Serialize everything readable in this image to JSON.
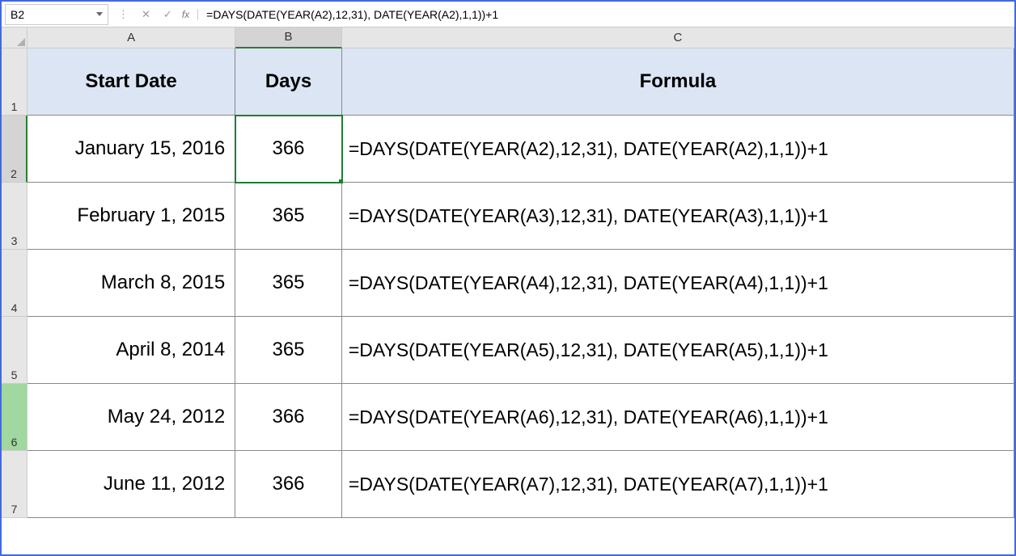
{
  "formula_bar": {
    "cell_ref": "B2",
    "fx_label": "fx",
    "formula": "=DAYS(DATE(YEAR(A2),12,31), DATE(YEAR(A2),1,1))+1"
  },
  "columns": [
    "A",
    "B",
    "C"
  ],
  "active_column": "B",
  "row_numbers": [
    "1",
    "2",
    "3",
    "4",
    "5",
    "6",
    "7"
  ],
  "active_row": "2",
  "selected_rows": [
    "6"
  ],
  "headers": {
    "start_date": "Start Date",
    "days": "Days",
    "formula": "Formula"
  },
  "rows": [
    {
      "start_date": "January 15, 2016",
      "days": "366",
      "formula": "=DAYS(DATE(YEAR(A2),12,31), DATE(YEAR(A2),1,1))+1"
    },
    {
      "start_date": "February 1, 2015",
      "days": "365",
      "formula": "=DAYS(DATE(YEAR(A3),12,31), DATE(YEAR(A3),1,1))+1"
    },
    {
      "start_date": "March 8, 2015",
      "days": "365",
      "formula": "=DAYS(DATE(YEAR(A4),12,31), DATE(YEAR(A4),1,1))+1"
    },
    {
      "start_date": "April 8, 2014",
      "days": "365",
      "formula": "=DAYS(DATE(YEAR(A5),12,31), DATE(YEAR(A5),1,1))+1"
    },
    {
      "start_date": "May 24, 2012",
      "days": "366",
      "formula": "=DAYS(DATE(YEAR(A6),12,31), DATE(YEAR(A6),1,1))+1"
    },
    {
      "start_date": "June 11, 2012",
      "days": "366",
      "formula": "=DAYS(DATE(YEAR(A7),12,31), DATE(YEAR(A7),1,1))+1"
    }
  ]
}
